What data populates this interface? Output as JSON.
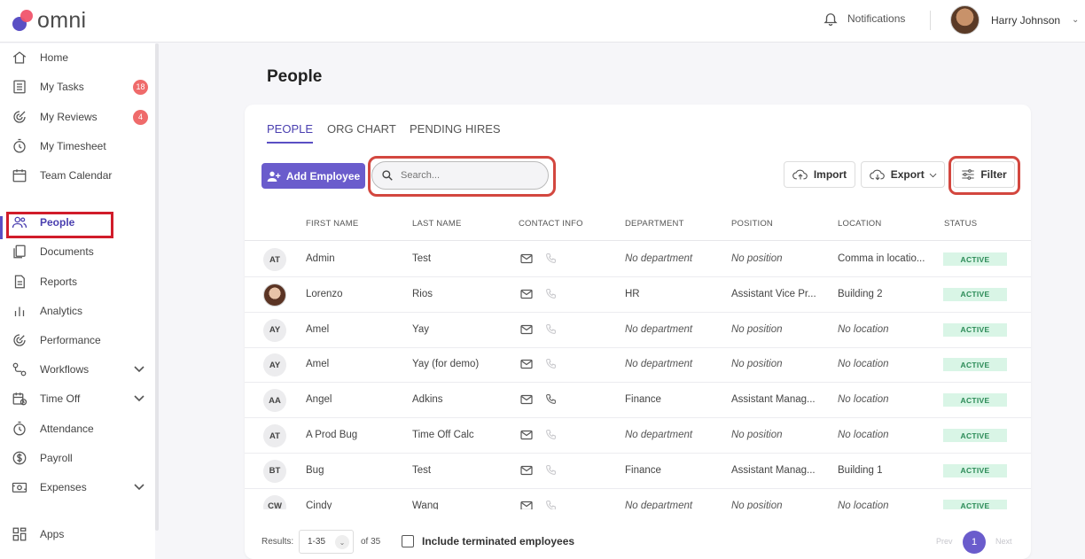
{
  "brand": {
    "name": "omni"
  },
  "header": {
    "notifications_label": "Notifications",
    "user_name": "Harry Johnson"
  },
  "sidebar": {
    "items": [
      {
        "label": "Home",
        "icon": "home-icon"
      },
      {
        "label": "My Tasks",
        "icon": "tasks-icon",
        "badge": "18"
      },
      {
        "label": "My Reviews",
        "icon": "reviews-icon",
        "badge": "4"
      },
      {
        "label": "My Timesheet",
        "icon": "stopwatch-icon"
      },
      {
        "label": "Team Calendar",
        "icon": "calendar-icon"
      },
      {
        "label": "People",
        "icon": "people-icon",
        "active": true
      },
      {
        "label": "Documents",
        "icon": "documents-icon"
      },
      {
        "label": "Reports",
        "icon": "reports-icon"
      },
      {
        "label": "Analytics",
        "icon": "analytics-icon"
      },
      {
        "label": "Performance",
        "icon": "performance-icon"
      },
      {
        "label": "Workflows",
        "icon": "workflows-icon",
        "expandable": true
      },
      {
        "label": "Time Off",
        "icon": "time-off-icon",
        "expandable": true
      },
      {
        "label": "Attendance",
        "icon": "attendance-icon"
      },
      {
        "label": "Payroll",
        "icon": "payroll-icon"
      },
      {
        "label": "Expenses",
        "icon": "expenses-icon",
        "expandable": true
      },
      {
        "label": "Apps",
        "icon": "apps-icon"
      }
    ]
  },
  "main": {
    "title": "People",
    "tabs": [
      "PEOPLE",
      "ORG CHART",
      "PENDING HIRES"
    ],
    "add_employee_label": "Add Employee",
    "search": {
      "placeholder": "Search...",
      "value": ""
    },
    "import_label": "Import",
    "export_label": "Export",
    "filter_label": "Filter",
    "columns": [
      "FIRST NAME",
      "LAST NAME",
      "CONTACT INFO",
      "DEPARTMENT",
      "POSITION",
      "LOCATION",
      "STATUS"
    ],
    "rows": [
      {
        "initials": "AT",
        "first": "Admin",
        "last": "Test",
        "department": "No department",
        "position": "No position",
        "location": "Comma in locatio...",
        "status": "ACTIVE",
        "phone_active": false
      },
      {
        "initials": "",
        "photo": true,
        "first": "Lorenzo",
        "last": "Rios",
        "department": "HR",
        "position": "Assistant Vice Pr...",
        "location": "Building 2",
        "status": "ACTIVE",
        "phone_active": false
      },
      {
        "initials": "AY",
        "first": "Amel",
        "last": "Yay",
        "department": "No department",
        "position": "No position",
        "location": "No location",
        "status": "ACTIVE",
        "phone_active": false
      },
      {
        "initials": "AY",
        "first": "Amel",
        "last": "Yay (for demo)",
        "department": "No department",
        "position": "No position",
        "location": "No location",
        "status": "ACTIVE",
        "phone_active": false
      },
      {
        "initials": "AA",
        "first": "Angel",
        "last": "Adkins",
        "department": "Finance",
        "position": "Assistant Manag...",
        "location": "No location",
        "status": "ACTIVE",
        "phone_active": true
      },
      {
        "initials": "AT",
        "first": "A Prod Bug",
        "last": "Time Off Calc",
        "department": "No department",
        "position": "No position",
        "location": "No location",
        "status": "ACTIVE",
        "phone_active": false
      },
      {
        "initials": "BT",
        "first": "Bug",
        "last": "Test",
        "department": "Finance",
        "position": "Assistant Manag...",
        "location": "Building 1",
        "status": "ACTIVE",
        "phone_active": false
      },
      {
        "initials": "CW",
        "first": "Cindy",
        "last": "Wang",
        "department": "No department",
        "position": "No position",
        "location": "No location",
        "status": "ACTIVE",
        "phone_active": false
      }
    ],
    "footer": {
      "results_label": "Results:",
      "range": "1-35",
      "of_total": "of 35",
      "include_terminated_label": "Include terminated employees",
      "prev_label": "Prev",
      "current_page": "1",
      "next_label": "Next"
    }
  },
  "colors": {
    "accent": "#5a4fc4",
    "badge": "#ef6b6b",
    "status_bg": "#d9f5e6",
    "highlight": "#d3473f"
  }
}
